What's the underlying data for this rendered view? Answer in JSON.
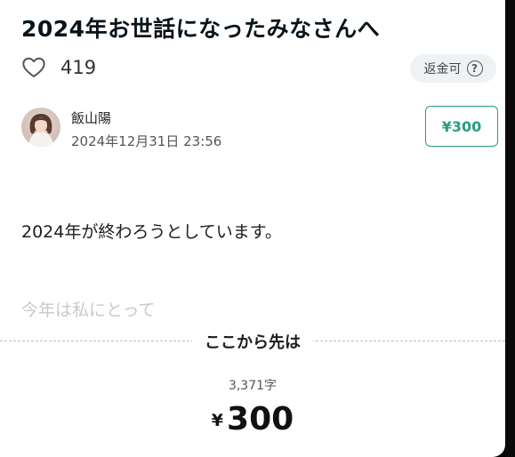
{
  "article": {
    "title": "2024年お世話になったみなさんへ",
    "likes": "419",
    "refund_label": "返金可",
    "help_glyph": "?",
    "author": "飯山陽",
    "date": "2024年12月31日 23:56",
    "price_badge": "¥300",
    "body_line": "2024年が終わろうとしています。",
    "fade_line": "今年は私にとって"
  },
  "paywall": {
    "label": "ここから先は",
    "char_count": "3,371字",
    "currency": "¥",
    "amount": "300"
  },
  "colors": {
    "accent": "#2c9c80",
    "title": "#08131a",
    "refund_bg": "#eff2f4"
  },
  "icons": {
    "like": "heart-outline-icon",
    "help": "question-circle-icon"
  }
}
